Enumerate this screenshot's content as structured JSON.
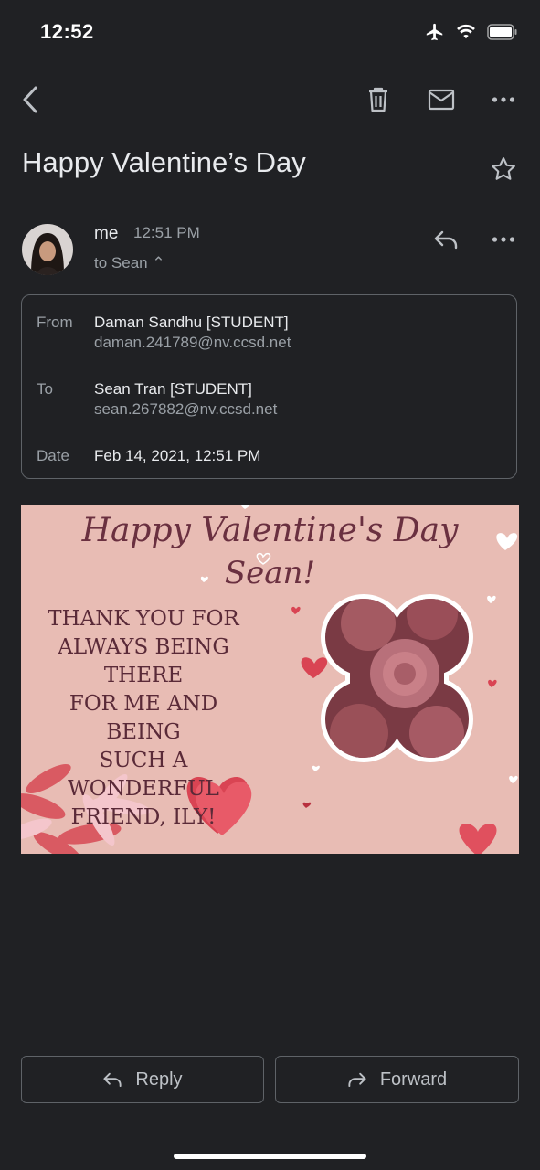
{
  "status": {
    "time": "12:52"
  },
  "message": {
    "subject": "Happy Valentine’s Day",
    "sender": "me",
    "time": "12:51 PM",
    "to_summary": "to Sean ⌃"
  },
  "details": {
    "from_label": "From",
    "from_name": "Daman Sandhu [STUDENT]",
    "from_email": "daman.241789@nv.ccsd.net",
    "to_label": "To",
    "to_name": "Sean Tran [STUDENT]",
    "to_email": "sean.267882@nv.ccsd.net",
    "date_label": "Date",
    "date_value": "Feb 14, 2021, 12:51 PM"
  },
  "card": {
    "heading_line1": "Happy Valentine's Day",
    "heading_line2": "Sean!",
    "body_lines": [
      "THANK YOU FOR",
      "ALWAYS BEING THERE",
      "FOR ME AND BEING",
      "SUCH A WONDERFUL",
      "FRIEND, ILY!"
    ]
  },
  "actions": {
    "reply": "Reply",
    "forward": "Forward"
  },
  "icons": {
    "back": "chevron-left-icon",
    "delete": "trash-icon",
    "unread": "mail-icon",
    "more": "more-horizontal-icon",
    "star": "star-icon",
    "reply": "reply-icon",
    "forward": "forward-icon"
  },
  "colors": {
    "background": "#202124",
    "card_bg": "#e8bcb4",
    "heart": "#e24a5a",
    "card_text": "#5a2a38"
  }
}
